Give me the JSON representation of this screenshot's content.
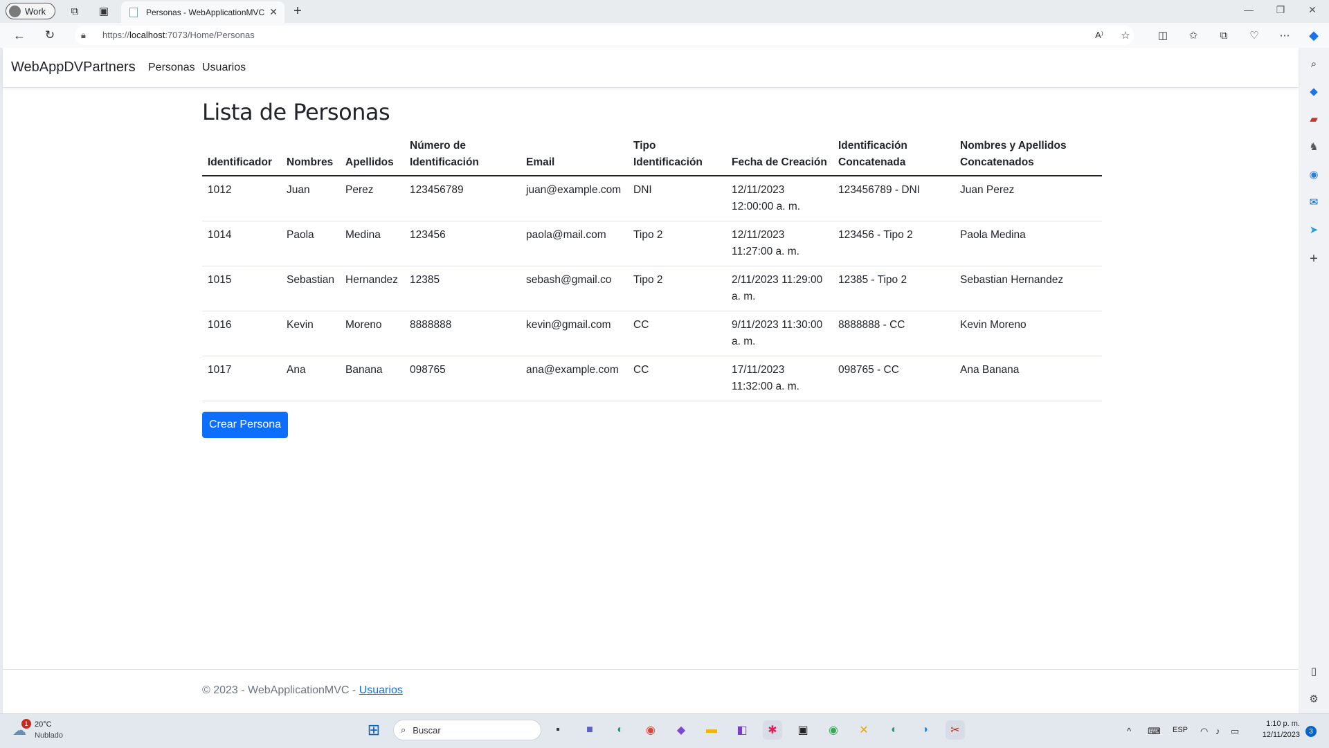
{
  "browser": {
    "profile_label": "Work",
    "tab_title": "Personas - WebApplicationMVC",
    "tab_close": "✕",
    "new_tab": "+",
    "url_prefix": "https://",
    "url_host": "localhost",
    "url_rest": ":7073/Home/Personas",
    "read_aloud": "A⁾"
  },
  "navbar": {
    "brand": "WebAppDVPartners",
    "links": [
      "Personas",
      "Usuarios"
    ]
  },
  "main": {
    "heading": "Lista de Personas",
    "table": {
      "headers": [
        [
          "Identificador"
        ],
        [
          "Nombres"
        ],
        [
          "Apellidos"
        ],
        [
          "Número de",
          "Identificación"
        ],
        [
          "Email"
        ],
        [
          "Tipo",
          "Identificación"
        ],
        [
          "Fecha de Creación"
        ],
        [
          "Identificación",
          "Concatenada"
        ],
        [
          "Nombres y Apellidos",
          "Concatenados"
        ]
      ],
      "rows": [
        [
          "1012",
          "Juan",
          "Perez",
          "123456789",
          "juan@example.com",
          "DNI",
          "12/11/2023 12:00:00 a. m.",
          "123456789 - DNI",
          "Juan Perez"
        ],
        [
          "1014",
          "Paola",
          "Medina",
          "123456",
          "paola@mail.com",
          "Tipo 2",
          "12/11/2023 11:27:00 a. m.",
          "123456 - Tipo 2",
          "Paola Medina"
        ],
        [
          "1015",
          "Sebastian",
          "Hernandez",
          "12385",
          "sebash@gmail.co",
          "Tipo 2",
          "2/11/2023 11:29:00 a. m.",
          "12385 - Tipo 2",
          "Sebastian Hernandez"
        ],
        [
          "1016",
          "Kevin",
          "Moreno",
          "8888888",
          "kevin@gmail.com",
          "CC",
          "9/11/2023 11:30:00 a. m.",
          "8888888 - CC",
          "Kevin Moreno"
        ],
        [
          "1017",
          "Ana",
          "Banana",
          "098765",
          "ana@example.com",
          "CC",
          "17/11/2023 11:32:00 a. m.",
          "098765 - CC",
          "Ana Banana"
        ]
      ]
    },
    "create_button": "Crear Persona"
  },
  "footer": {
    "text": "© 2023 - WebApplicationMVC - ",
    "link": "Usuarios"
  },
  "taskbar": {
    "weather_temp": "20°C",
    "weather_desc": "Nublado",
    "weather_badge": "1",
    "search_placeholder": "Buscar",
    "lang": "ESP",
    "time": "1:10 p. m.",
    "date": "12/11/2023",
    "notif_count": "3"
  },
  "colors": {
    "primary": "#0d6efd",
    "page_bg": "#ffffff",
    "chrome_bg": "#e9ecef"
  }
}
